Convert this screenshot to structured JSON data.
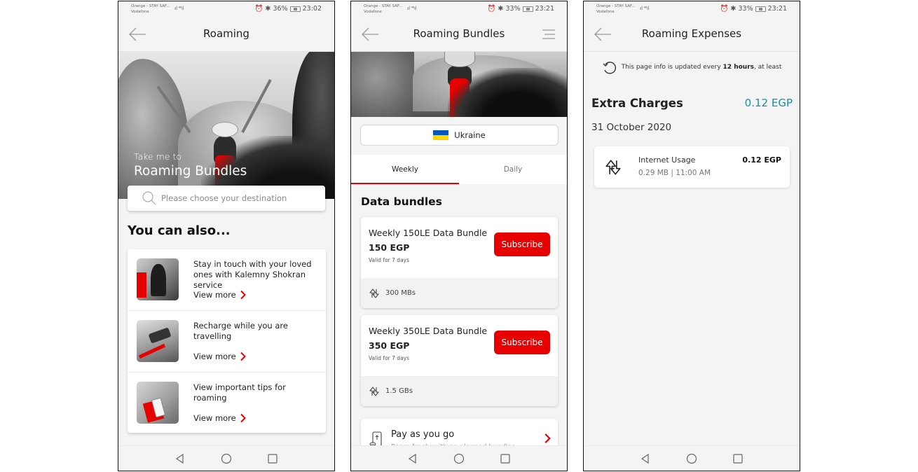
{
  "theme": {
    "accent": "#e60000",
    "teal": "#1c8ea0",
    "flag_blue": "#0057b7",
    "flag_yellow": "#ffd700"
  },
  "screens": [
    {
      "status": {
        "carrier1": "Orange - STAY SAF...",
        "carrier2": "Vodafone",
        "signal": "ᵢıl ⁴⁶ıl",
        "alarm_icon": "alarm-icon",
        "bt_icon": "bluetooth-icon",
        "battery": "36%",
        "time": "23:02"
      },
      "header": {
        "title": "Roaming",
        "back_icon": "back-arrow-icon"
      },
      "hero": {
        "subtitle": "Take me to",
        "title": "Roaming Bundles"
      },
      "search": {
        "placeholder": "Please choose your destination",
        "icon": "search-icon"
      },
      "section_title": "You can also...",
      "items": [
        {
          "text": "Stay in touch with your loved ones with Kalemny Shokran service",
          "link": "View more"
        },
        {
          "text": "Recharge while you are travelling",
          "link": "View more"
        },
        {
          "text": "View important tips for roaming",
          "link": "View more"
        }
      ]
    },
    {
      "status": {
        "carrier1": "Orange - STAY SAF...",
        "carrier2": "Vodafone",
        "signal": "ᵢıl ⁴⁶ıl",
        "battery": "33%",
        "time": "23:21"
      },
      "header": {
        "title": "Roaming Bundles",
        "back_icon": "back-arrow-icon",
        "menu_icon": "hamburger-menu-icon"
      },
      "country": {
        "name": "Ukraine",
        "flag": "ukraine-flag"
      },
      "tabs": [
        {
          "label": "Weekly",
          "active": true
        },
        {
          "label": "Daily",
          "active": false
        }
      ],
      "section_title": "Data bundles",
      "bundles": [
        {
          "name": "Weekly 150LE Data Bundle",
          "price": "150 EGP",
          "validity": "Valid for 7 days",
          "button": "Subscribe",
          "data": "300 MBs"
        },
        {
          "name": "Weekly 350LE Data Bundle",
          "price": "350 EGP",
          "validity": "Valid for 7 days",
          "button": "Subscribe",
          "data": "1.5 GBs"
        }
      ],
      "payg": {
        "title": "Pay as you go",
        "subtitle": "Roam freely with no planned bundles"
      }
    },
    {
      "status": {
        "carrier1": "Orange - STAY SAF...",
        "carrier2": "Vodafone",
        "signal": "ᵢıl ⁴⁶ıl",
        "battery": "33%",
        "time": "23:21"
      },
      "header": {
        "title": "Roaming Expenses",
        "back_icon": "back-arrow-icon"
      },
      "info": {
        "prefix": "This page info is updated every ",
        "bold": "12 hours",
        "suffix": ", at least"
      },
      "extra": {
        "title": "Extra Charges",
        "amount": "0.12 EGP",
        "date": "31 October 2020"
      },
      "usage": {
        "title": "Internet Usage",
        "detail": "0.29 MB | 11:00 AM",
        "amount": "0.12 EGP"
      }
    }
  ]
}
